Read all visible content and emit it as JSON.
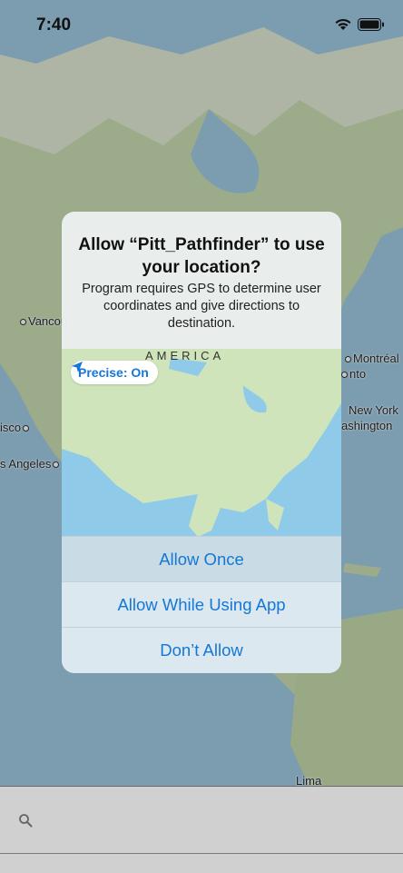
{
  "status_bar": {
    "time": "7:40"
  },
  "map_labels": {
    "vancouver": "Vancou",
    "montreal": "Montréal",
    "toronto": "nto",
    "new_york": "New York",
    "washington": "ashington",
    "francisco": "isco",
    "los_angeles": "s Angeles",
    "lima": "Lima"
  },
  "alert": {
    "title": "Allow “Pitt_Pathfinder” to use your location?",
    "message": "Program requires GPS to determine user coordinates and give directions to destination.",
    "map_label": "AMERICA",
    "precise_label": "Precise: On",
    "buttons": {
      "allow_once": "Allow Once",
      "allow_while_using": "Allow While Using App",
      "dont_allow": "Don’t Allow"
    }
  },
  "search": {
    "placeholder": ""
  },
  "icons": [
    "wifi-icon",
    "battery-icon",
    "location-arrow-icon",
    "search-icon"
  ]
}
